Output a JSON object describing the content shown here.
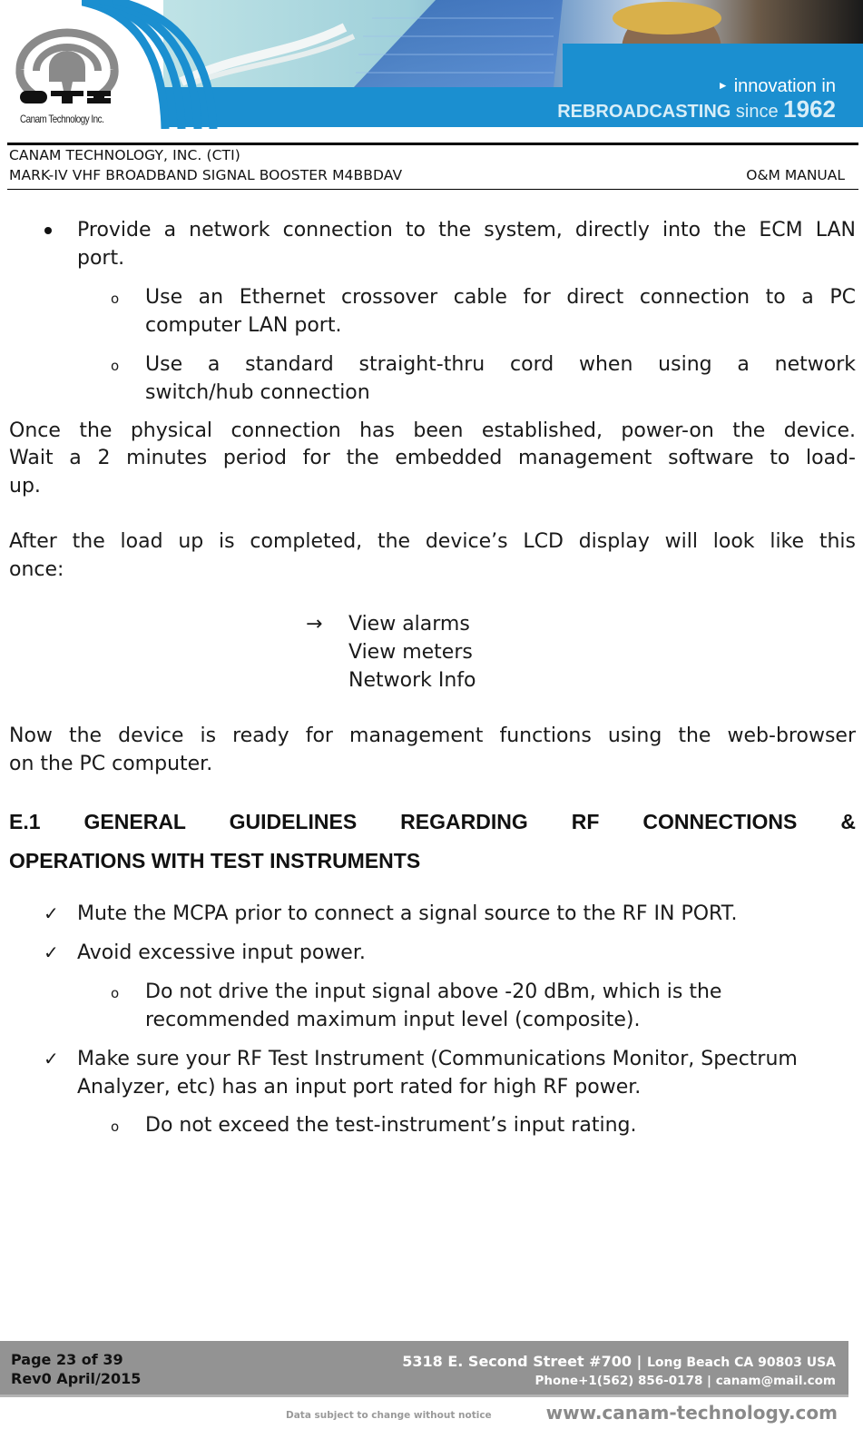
{
  "banner": {
    "logo_text": "CTI",
    "logo_subtext": "Canam Technology Inc.",
    "tagline_line1": "innovation in",
    "tagline_bold": "REBROADCASTING",
    "tagline_since": "since",
    "tagline_year": "1962",
    "colors": {
      "brand_blue": "#1b8fd0",
      "logo_gray": "#8a8a8a"
    }
  },
  "header": {
    "company": "CANAM TECHNOLOGY, INC. (CTI)",
    "product": "MARK-IV VHF BROADBAND SIGNAL BOOSTER M4BBDAV",
    "doc_type": "O&M MANUAL"
  },
  "body": {
    "bullet1": {
      "line1": "Provide a network connection to the system, directly into the ECM LAN",
      "line2": "port.",
      "sub": [
        {
          "line1": "Use an Ethernet crossover cable for direct connection to a PC",
          "line2": "computer LAN port."
        },
        {
          "line1": "Use a standard straight-thru cord when using a network",
          "line2": "switch/hub connection"
        }
      ]
    },
    "para1": {
      "line1": "Once the physical connection has been established, power-on the device.",
      "line2": "Wait a 2 minutes period for the embedded management software to load-",
      "line3": "up."
    },
    "para2": {
      "line1": "After the load up is completed, the device’s LCD display will look like this",
      "line2": "once:"
    },
    "lcd": {
      "arrow": "→",
      "items": [
        "View alarms",
        "View meters",
        "Network Info"
      ]
    },
    "para3": {
      "line1": "Now the device is ready for management functions using the web-browser",
      "line2": "on the PC computer."
    },
    "section": {
      "line1": "E.1 GENERAL GUIDELINES REGARDING RF CONNECTIONS &",
      "line2": "OPERATIONS WITH TEST INSTRUMENTS"
    },
    "checklist": [
      {
        "line1": "Mute the MCPA prior to connect a signal source to the RF IN PORT."
      },
      {
        "line1": "Avoid excessive input power.",
        "sub": {
          "line1": "Do not drive the input signal above -20 dBm, which is the",
          "line2": "recommended maximum input level (composite)."
        }
      },
      {
        "line1": "Make sure your RF Test Instrument (Communications Monitor, Spectrum",
        "line2": "Analyzer, etc) has an input port rated for high RF power.",
        "sub": {
          "line1": "Do not exceed the test-instrument’s input rating."
        }
      }
    ],
    "markers": {
      "circle": "o",
      "check": "✓"
    }
  },
  "footer": {
    "page": "Page 23 of 39",
    "revision": "Rev0 April/2015",
    "address_main": "5318 E. Second Street  #700 |",
    "address_city": "Long Beach CA 90803 USA",
    "contact": "Phone+1(562) 856-0178 | canam@mail.com",
    "notice": "Data subject to change without notice",
    "website": "www.canam-technology.com"
  }
}
